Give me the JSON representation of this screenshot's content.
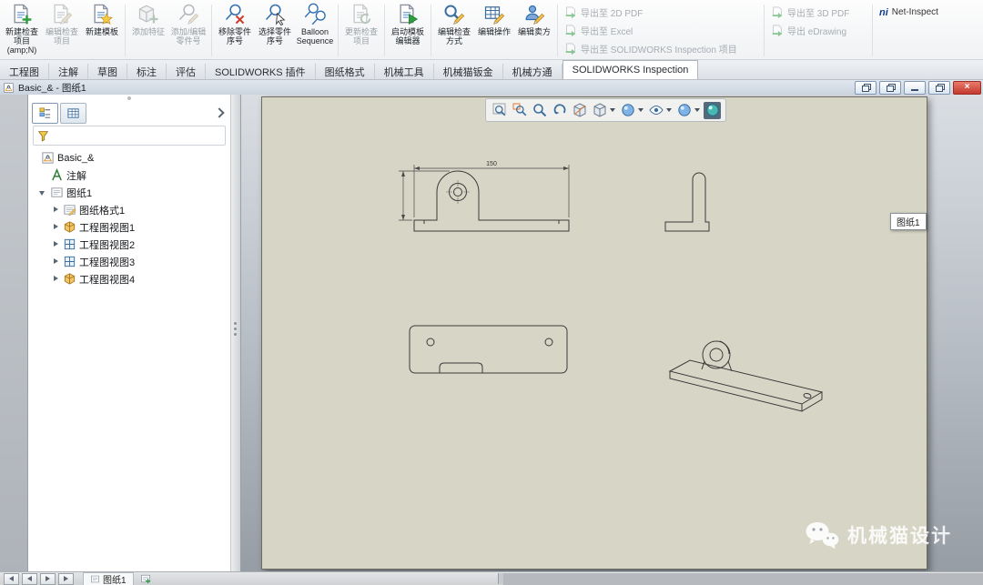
{
  "ribbon": {
    "buttons": [
      {
        "label": "新建检查项目 (amp;N)",
        "icon": "new-inspection-project",
        "enabled": true
      },
      {
        "label": "编辑检查项目",
        "icon": "edit-inspection-project",
        "enabled": false
      },
      {
        "label": "新建模板",
        "icon": "new-template",
        "enabled": true
      },
      {
        "label": "添加特征",
        "icon": "add-feature",
        "enabled": false
      },
      {
        "label": "添加/编辑零件号",
        "icon": "add-edit-balloon",
        "enabled": false
      },
      {
        "label": "移除零件序号",
        "icon": "remove-balloon",
        "enabled": true
      },
      {
        "label": "选择零件序号",
        "icon": "select-balloon",
        "enabled": true
      },
      {
        "label": "Balloon Sequence",
        "icon": "balloon-sequence",
        "enabled": true
      },
      {
        "label": "更新检查项目",
        "icon": "update-inspection-project",
        "enabled": false
      },
      {
        "label": "启动模板编辑器",
        "icon": "launch-template-editor",
        "enabled": true
      },
      {
        "label": "编辑检查方式",
        "icon": "edit-inspection-method",
        "enabled": true
      },
      {
        "label": "编辑操作",
        "icon": "edit-operation",
        "enabled": true
      },
      {
        "label": "编辑卖方",
        "icon": "edit-vendor",
        "enabled": true
      }
    ],
    "export_items": [
      {
        "label": "导出至 2D PDF",
        "enabled": false
      },
      {
        "label": "导出至 Excel",
        "enabled": false
      },
      {
        "label": "导出至 SOLIDWORKS Inspection 项目",
        "enabled": false
      },
      {
        "label": "导出至 3D PDF",
        "enabled": false
      },
      {
        "label": "导出 eDrawing",
        "enabled": false
      },
      {
        "label": "Net-Inspect",
        "enabled": true
      }
    ]
  },
  "tabs": [
    {
      "label": "工程图",
      "active": false
    },
    {
      "label": "注解",
      "active": false
    },
    {
      "label": "草图",
      "active": false
    },
    {
      "label": "标注",
      "active": false
    },
    {
      "label": "评估",
      "active": false
    },
    {
      "label": "SOLIDWORKS 插件",
      "active": false
    },
    {
      "label": "图纸格式",
      "active": false
    },
    {
      "label": "机械工具",
      "active": false
    },
    {
      "label": "机械猫钣金",
      "active": false
    },
    {
      "label": "机械方通",
      "active": false
    },
    {
      "label": "SOLIDWORKS Inspection",
      "active": true
    }
  ],
  "doc": {
    "title": "Basic_& - 图纸1"
  },
  "tree": {
    "items": [
      {
        "label": "Basic_&",
        "icon": "drawing-document",
        "level": 0
      },
      {
        "label": "注解",
        "icon": "annotations",
        "level": 1
      },
      {
        "label": "图纸1",
        "icon": "sheet",
        "level": 1,
        "expanded": true
      },
      {
        "label": "图纸格式1",
        "icon": "sheet-format",
        "level": 2
      },
      {
        "label": "工程图视图1",
        "icon": "drawing-view-iso",
        "level": 2
      },
      {
        "label": "工程图视图2",
        "icon": "drawing-view-projected",
        "level": 2
      },
      {
        "label": "工程图视图3",
        "icon": "drawing-view-projected",
        "level": 2
      },
      {
        "label": "工程图视图4",
        "icon": "drawing-view-iso",
        "level": 2
      }
    ]
  },
  "viewport": {
    "sheet_tag": "图纸1",
    "toolbar_icons": [
      "zoom-fit",
      "zoom-area",
      "zoom",
      "previous-view",
      "section-view",
      "view-orientation",
      "display-style",
      "hide-show-items",
      "appearances",
      "realview"
    ]
  },
  "drawing": {
    "dim_150": "150"
  },
  "statusbar": {
    "sheet_tab": "图纸1"
  },
  "watermark": {
    "text": "机械猫设计"
  },
  "colors": {
    "close_button": "#c4392f",
    "sheet_background": "#d7d6c6",
    "viewport_top": "#dadee3",
    "viewport_bottom": "#969da5",
    "drawing_line": "#3a3a3a"
  }
}
